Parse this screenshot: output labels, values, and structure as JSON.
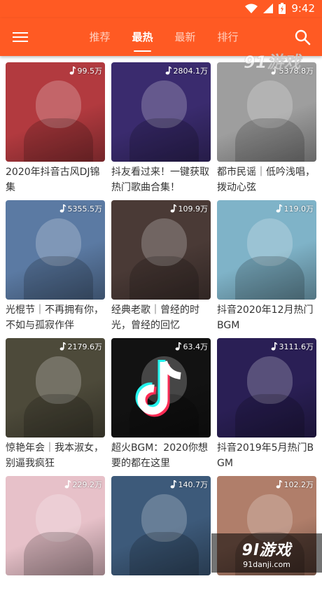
{
  "status_bar": {
    "time": "9:42"
  },
  "top_bar": {
    "tabs": [
      {
        "label": "推荐"
      },
      {
        "label": "最热"
      },
      {
        "label": "最新"
      },
      {
        "label": "排行"
      }
    ],
    "active_tab": "最热"
  },
  "playlists": [
    {
      "count": "99.5万",
      "title": "2020年抖音古风DJ锦集",
      "color": "#b23a3f"
    },
    {
      "count": "2804.1万",
      "title": "抖友看过来！一键获取热门歌曲合集！",
      "color": "#3a2b6e"
    },
    {
      "count": "5378.8万",
      "title": "都市民谣｜低吟浅唱，拨动心弦",
      "color": "#9e9e9e"
    },
    {
      "count": "5355.5万",
      "title": "光棍节｜不再拥有你，不如与孤寂作伴",
      "color": "#5b7aa3"
    },
    {
      "count": "109.9万",
      "title": "经典老歌｜曾经的时光，曾经的回忆",
      "color": "#4a3a36"
    },
    {
      "count": "119.0万",
      "title": "抖音2020年12月热门BGM",
      "color": "#7fb3c8"
    },
    {
      "count": "2179.6万",
      "title": "惊艳年会｜我本淑女，别逼我疯狂",
      "color": "#4d4a3a"
    },
    {
      "count": "63.4万",
      "title": "超火BGM：2020你想要的都在这里",
      "color": "#121212"
    },
    {
      "count": "3111.6万",
      "title": "抖音2019年5月热门BGM",
      "color": "#2a1f55"
    },
    {
      "count": "229.2万",
      "title": "",
      "color": "#e7c1c9"
    },
    {
      "count": "140.7万",
      "title": "",
      "color": "#3d5a7a"
    },
    {
      "count": "102.2万",
      "title": "",
      "color": "#b07e6a"
    }
  ],
  "watermarks": {
    "top": "91游戏",
    "bottom_main": "9l游戏",
    "bottom_sub": "91danji.com"
  },
  "colors": {
    "brand": "#ff5a23"
  },
  "icons": {
    "menu": "hamburger-icon",
    "search": "search-icon",
    "count": "music-note-icon"
  }
}
